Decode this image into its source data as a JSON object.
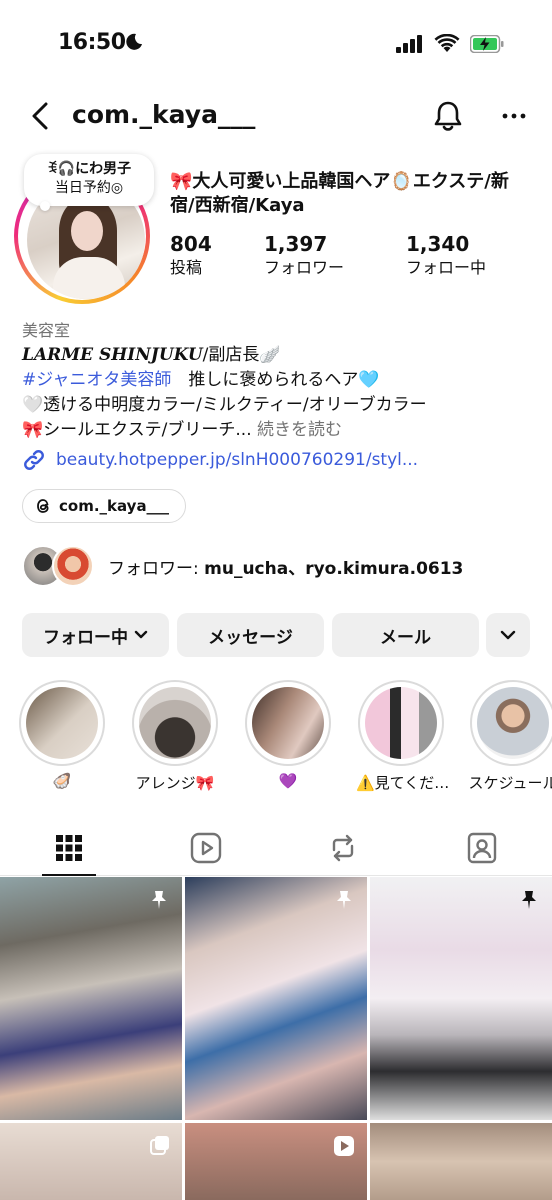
{
  "status_bar": {
    "time": "16:50"
  },
  "nav": {
    "username": "com._kaya___"
  },
  "note": {
    "line1": "ꉂ🎧にわ男子",
    "line2": "当日予約◎"
  },
  "profile": {
    "full_name": "🎀大人可愛い上品韓国ヘア🪞エクステ/新宿/西新宿/Kaya",
    "stats": [
      {
        "value": "804",
        "label": "投稿"
      },
      {
        "value": "1,397",
        "label": "フォロワー"
      },
      {
        "value": "1,340",
        "label": "フォロー中"
      }
    ]
  },
  "bio": {
    "category": "美容室",
    "line1_brand": "LARME SHINJUKU",
    "line1_rest": "/副店長🪽",
    "line2_hashtag": "#ジャニオタ美容師",
    "line2_rest": "　推しに褒められるヘア🩵",
    "line3": "🤍透ける中明度カラー/ミルクティー/オリーブカラー",
    "line4": "🎀シールエクステ/ブリーチ...",
    "more": "続きを読む",
    "link": "beauty.hotpepper.jp/slnH000760291/styl..."
  },
  "threads_chip": {
    "label": "com._kaya___"
  },
  "followed_by": {
    "prefix": "フォロワー: ",
    "names": "mu_ucha、ryo.kimura.0613"
  },
  "buttons": {
    "following": "フォロー中",
    "message": "メッセージ",
    "email": "メール"
  },
  "highlights": [
    {
      "label": "🦪",
      "color_a": "#6b5a48",
      "color_b": "#d9cfc4"
    },
    {
      "label": "アレンジ🎀",
      "color_a": "#3a3430",
      "color_b": "#d8d3cf"
    },
    {
      "label": "💜",
      "color_a": "#40302a",
      "color_b": "#e0c9c0"
    },
    {
      "label": "⚠️見てくだ…",
      "color_a": "#f2c7da",
      "color_b": "#2b2b2b"
    },
    {
      "label": "スケジュール",
      "color_a": "#c9cfd6",
      "color_b": "#f1f1f1"
    }
  ],
  "tabs": [
    "grid-tab",
    "reels-tab",
    "reposts-tab",
    "tagged-tab"
  ],
  "colors": {
    "link": "#3b5bdb",
    "button_bg": "#efefef",
    "muted": "#737373"
  }
}
